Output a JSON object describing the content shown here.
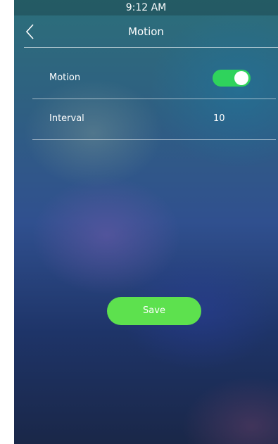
{
  "status_bar": {
    "time": "9:12 AM"
  },
  "header": {
    "title": "Motion",
    "back_icon": "chevron-left-icon"
  },
  "settings": {
    "motion": {
      "label": "Motion",
      "enabled": true
    },
    "interval": {
      "label": "Interval",
      "value": "10"
    }
  },
  "actions": {
    "save_label": "Save"
  },
  "colors": {
    "toggle_on": "#2fd35c",
    "save_button": "#5de14e",
    "text": "#ffffff"
  }
}
